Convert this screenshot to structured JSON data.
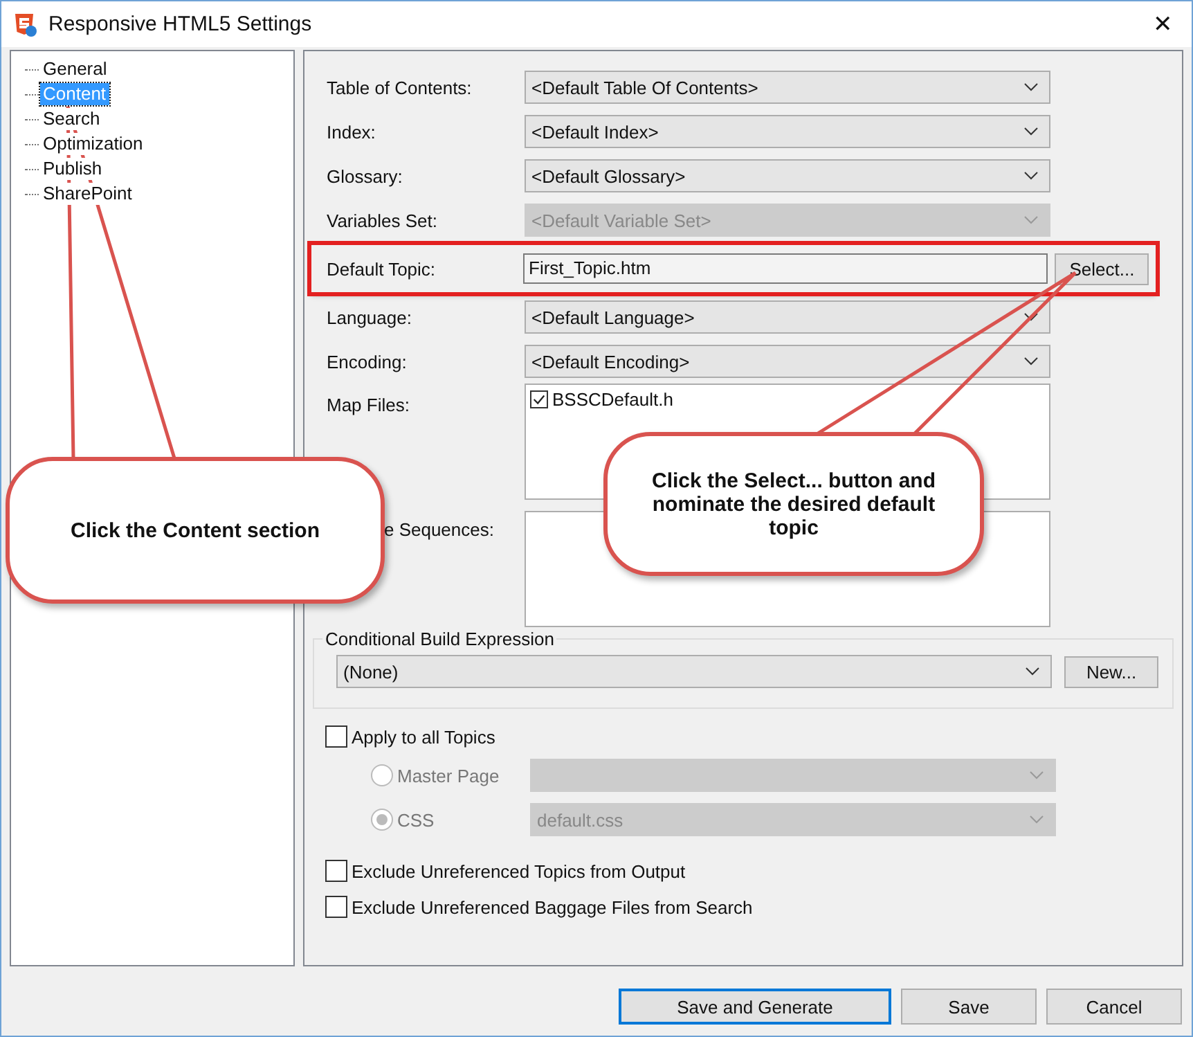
{
  "window": {
    "title": "Responsive HTML5 Settings",
    "close": "✕"
  },
  "tree": {
    "items": [
      {
        "label": "General",
        "selected": false
      },
      {
        "label": "Content",
        "selected": true
      },
      {
        "label": "Search",
        "selected": false
      },
      {
        "label": "Optimization",
        "selected": false
      },
      {
        "label": "Publish",
        "selected": false
      },
      {
        "label": "SharePoint",
        "selected": false
      }
    ]
  },
  "fields": [
    {
      "kind": "combo",
      "label": "Table of Contents:",
      "value": "<Default Table Of Contents>",
      "disabled": false
    },
    {
      "kind": "combo",
      "label": "Index:",
      "value": "<Default Index>",
      "disabled": false
    },
    {
      "kind": "combo",
      "label": "Glossary:",
      "value": "<Default Glossary>",
      "disabled": false
    },
    {
      "kind": "combo",
      "label": "Variables Set:",
      "value": "<Default Variable Set>",
      "disabled": true
    },
    {
      "kind": "text",
      "label": "Default Topic:",
      "value": "First_Topic.htm",
      "button": "Select...",
      "highlighted": true
    },
    {
      "kind": "combo",
      "label": "Language:",
      "value": "<Default Language>",
      "disabled": false
    },
    {
      "kind": "combo",
      "label": "Encoding:",
      "value": "<Default Encoding>",
      "disabled": false
    },
    {
      "kind": "list",
      "label": "Map Files:",
      "items": [
        {
          "label": "BSSCDefault.h",
          "checked": true
        }
      ]
    },
    {
      "kind": "list",
      "label": "e Sequences:"
    }
  ],
  "conditional": {
    "title": "Conditional Build Expression",
    "value": "(None)",
    "button": "New..."
  },
  "apply": {
    "label": "Apply to all Topics",
    "checked": false
  },
  "options": [
    {
      "label": "Master Page",
      "selected": false
    },
    {
      "label": "CSS",
      "selected": true,
      "value": "default.css"
    }
  ],
  "excludes": [
    {
      "label": "Exclude Unreferenced Topics from Output",
      "checked": false
    },
    {
      "label": "Exclude Unreferenced Baggage Files from Search",
      "checked": false
    }
  ],
  "buttons": [
    {
      "label": "Save and Generate",
      "default": true
    },
    {
      "label": "Save",
      "default": false
    },
    {
      "label": "Cancel",
      "default": false
    }
  ],
  "callouts": [
    {
      "text": "Click the Content section"
    },
    {
      "text": "Click the Select... button and nominate the desired default topic"
    }
  ]
}
